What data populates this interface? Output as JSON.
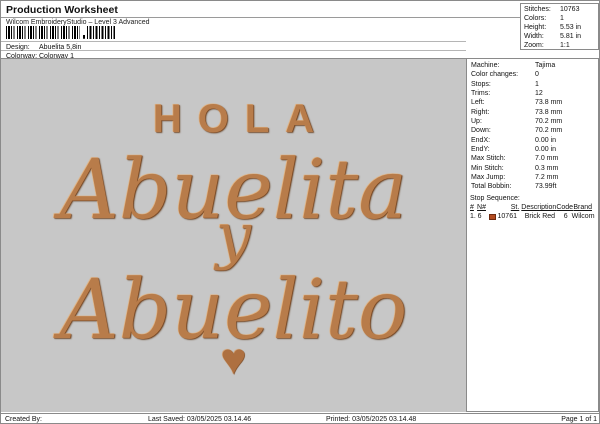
{
  "header": {
    "title": "Production Worksheet",
    "subtitle": "Wilcom EmbroideryStudio – Level 3 Advanced",
    "design_label": "Design:",
    "design_value": "Abuelita 5,8in",
    "colorway_label": "Colorway:",
    "colorway_value": "Colorway 1"
  },
  "info_box": {
    "rows": [
      {
        "label": "Stitches:",
        "value": "10763"
      },
      {
        "label": "Colors:",
        "value": "1"
      },
      {
        "label": "Height:",
        "value": "5.53 in"
      },
      {
        "label": "Width:",
        "value": "5.81 in"
      },
      {
        "label": "Zoom:",
        "value": "1:1"
      }
    ]
  },
  "machine_box": {
    "rows": [
      {
        "label": "Machine:",
        "value": "Tajima"
      },
      {
        "label": "Color changes:",
        "value": "0"
      },
      {
        "label": "Stops:",
        "value": "1"
      },
      {
        "label": "Trims:",
        "value": "12"
      },
      {
        "label": "Left:",
        "value": "73.8 mm"
      },
      {
        "label": "Right:",
        "value": "73.8 mm"
      },
      {
        "label": "Up:",
        "value": "70.2 mm"
      },
      {
        "label": "Down:",
        "value": "70.2 mm"
      },
      {
        "label": "EndX:",
        "value": "0.00 in"
      },
      {
        "label": "EndY:",
        "value": "0.00 in"
      },
      {
        "label": "Max Stitch:",
        "value": "7.0 mm"
      },
      {
        "label": "Min Stitch:",
        "value": "0.3 mm"
      },
      {
        "label": "Max Jump:",
        "value": "7.2 mm"
      },
      {
        "label": "Total Bobbin:",
        "value": "73.99ft"
      }
    ]
  },
  "stop_sequence": {
    "title": "Stop Sequence:",
    "headers": {
      "h1": "#",
      "h2": "N#",
      "h3": "St.",
      "h4": "Description",
      "h5": "Code",
      "h6": "Brand"
    },
    "row": {
      "seq": "1.",
      "needle": "6",
      "stitches": "10761",
      "description": "Brick Red",
      "code": "6",
      "brand": "Wilcom",
      "swatch_color": "#b34b20"
    }
  },
  "design": {
    "line1": "HOLA",
    "line2": "Abuelita",
    "line3": "y",
    "line4": "Abuelito",
    "heart": "♥",
    "thread_color": "#b87c4a",
    "background_color": "#c7c7c7"
  },
  "footer": {
    "created_by": "Created By:",
    "last_saved": "Last Saved: 03/05/2025 03.14.46",
    "printed": "Printed: 03/05/2025 03.14.48",
    "page": "Page 1 of 1"
  }
}
